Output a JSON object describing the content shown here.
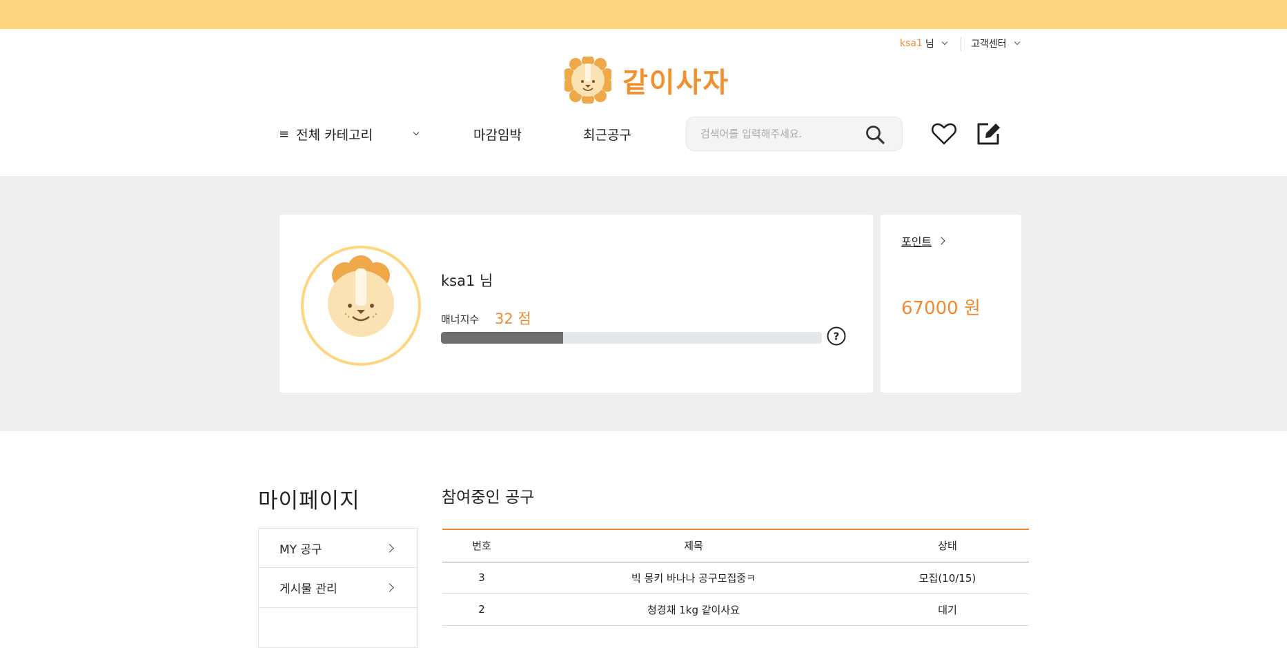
{
  "header": {
    "user_id": "ksa1",
    "user_suffix": "님",
    "customer_center": "고객센터",
    "logo_text": "같이사자"
  },
  "nav": {
    "all_categories": "전체 카테고리",
    "deadline": "마감임박",
    "recent": "최근공구",
    "search_placeholder": "검색어를 입력해주세요."
  },
  "profile": {
    "name": "ksa1 님",
    "manner_label": "매너지수",
    "manner_score": "32 점",
    "manner_value": 32,
    "point_link": "포인트",
    "point_value": "67000 원"
  },
  "mypage": {
    "title": "마이페이지",
    "menu": [
      "MY 공구",
      "게시물 관리",
      ""
    ]
  },
  "participating": {
    "title": "참여중인 공구",
    "columns": [
      "번호",
      "제목",
      "상태"
    ],
    "rows": [
      {
        "no": "3",
        "title": "빅 몽키 바나나 공구모집중ㅋ",
        "status": "모집(10/15)"
      },
      {
        "no": "2",
        "title": "청경채 1kg 같이사요",
        "status": "대기"
      }
    ]
  },
  "colors": {
    "banner": "#ffd67f",
    "accent": "#f08a32",
    "band": "#efefef"
  }
}
